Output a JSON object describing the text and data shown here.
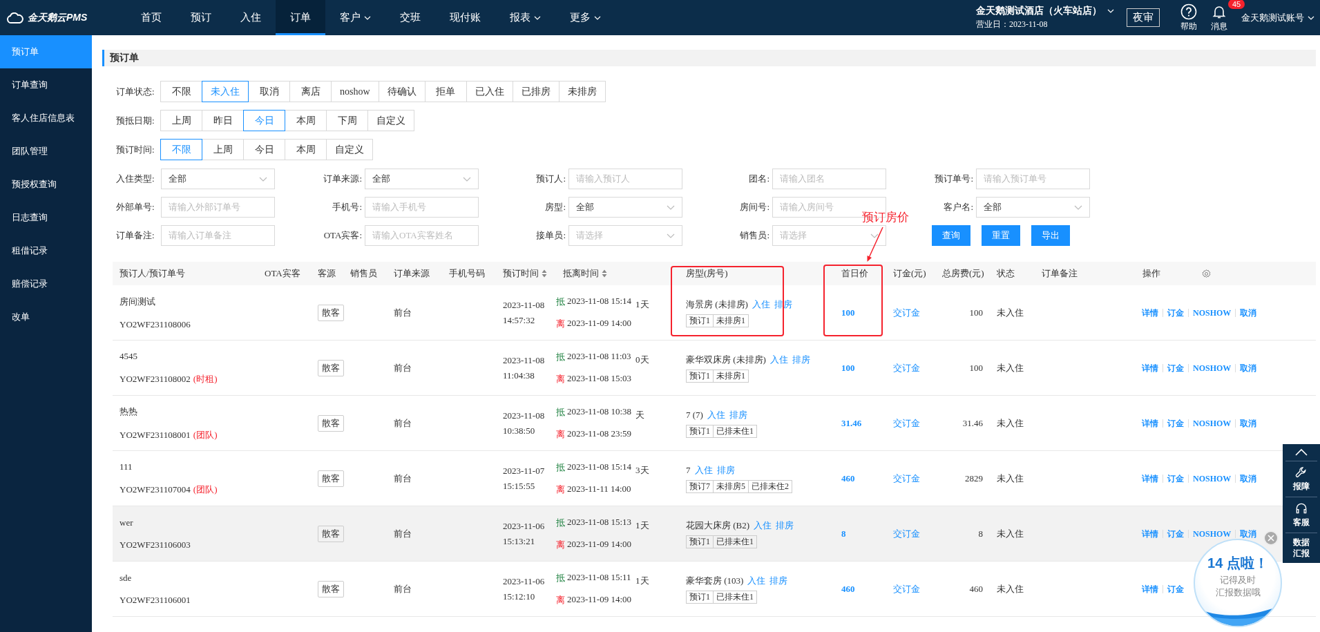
{
  "nav": {
    "logo": "金天鹅云PMS",
    "items": [
      {
        "label": "首页",
        "selected": false,
        "dropdown": false
      },
      {
        "label": "预订",
        "selected": false,
        "dropdown": false
      },
      {
        "label": "入住",
        "selected": false,
        "dropdown": false
      },
      {
        "label": "订单",
        "selected": true,
        "dropdown": false
      },
      {
        "label": "客户",
        "selected": false,
        "dropdown": true
      },
      {
        "label": "交班",
        "selected": false,
        "dropdown": false
      },
      {
        "label": "现付账",
        "selected": false,
        "dropdown": false
      },
      {
        "label": "报表",
        "selected": false,
        "dropdown": true
      },
      {
        "label": "更多",
        "selected": false,
        "dropdown": true
      }
    ],
    "hotel": "金天鹅测试酒店（火车站店）",
    "business_date": "营业日：2023-11-08",
    "night_audit": "夜审",
    "help": "帮助",
    "messages": "消息",
    "message_count": "45",
    "account": "金天鹅测试账号"
  },
  "sidebar": {
    "items": [
      {
        "label": "预订单",
        "selected": true
      },
      {
        "label": "订单查询",
        "selected": false
      },
      {
        "label": "客人住店信息表",
        "selected": false
      },
      {
        "label": "团队管理",
        "selected": false
      },
      {
        "label": "预授权查询",
        "selected": false
      },
      {
        "label": "日志查询",
        "selected": false
      },
      {
        "label": "租借记录",
        "selected": false
      },
      {
        "label": "赔偿记录",
        "selected": false
      },
      {
        "label": "改单",
        "selected": false
      }
    ]
  },
  "page_title": "预订单",
  "filter_groups": [
    {
      "label": "订单状态:",
      "options": [
        {
          "label": "不限",
          "selected": false
        },
        {
          "label": "未入住",
          "selected": true
        },
        {
          "label": "取消",
          "selected": false
        },
        {
          "label": "离店",
          "selected": false
        },
        {
          "label": "noshow",
          "selected": false
        },
        {
          "label": "待确认",
          "selected": false
        },
        {
          "label": "拒单",
          "selected": false
        },
        {
          "label": "已入住",
          "selected": false
        },
        {
          "label": "已排房",
          "selected": false
        },
        {
          "label": "未排房",
          "selected": false
        }
      ]
    },
    {
      "label": "预抵日期:",
      "options": [
        {
          "label": "上周",
          "selected": false
        },
        {
          "label": "昨日",
          "selected": false
        },
        {
          "label": "今日",
          "selected": true
        },
        {
          "label": "本周",
          "selected": false
        },
        {
          "label": "下周",
          "selected": false
        },
        {
          "label": "自定义",
          "selected": false
        }
      ]
    },
    {
      "label": "预订时间:",
      "options": [
        {
          "label": "不限",
          "selected": true
        },
        {
          "label": "上周",
          "selected": false
        },
        {
          "label": "今日",
          "selected": false
        },
        {
          "label": "本周",
          "selected": false
        },
        {
          "label": "自定义",
          "selected": false
        }
      ]
    }
  ],
  "field_rows": [
    [
      {
        "label": "入住类型:",
        "kind": "select",
        "value": "全部"
      },
      {
        "label": "订单来源:",
        "kind": "select",
        "value": "全部"
      },
      {
        "label": "预订人:",
        "kind": "input",
        "placeholder": "请输入预订人"
      },
      {
        "label": "团名:",
        "kind": "input",
        "placeholder": "请输入团名"
      },
      {
        "label": "预订单号:",
        "kind": "input",
        "placeholder": "请输入预订单号"
      }
    ],
    [
      {
        "label": "外部单号:",
        "kind": "input",
        "placeholder": "请输入外部订单号"
      },
      {
        "label": "手机号:",
        "kind": "input",
        "placeholder": "请输入手机号"
      },
      {
        "label": "房型:",
        "kind": "select",
        "value": "全部"
      },
      {
        "label": "房间号:",
        "kind": "input",
        "placeholder": "请输入房间号"
      },
      {
        "label": "客户名:",
        "kind": "select",
        "value": "全部"
      }
    ],
    [
      {
        "label": "订单备注:",
        "kind": "input",
        "placeholder": "请输入订单备注"
      },
      {
        "label": "OTA宾客:",
        "kind": "input",
        "placeholder": "请输入OTA宾客姓名"
      },
      {
        "label": "接单员:",
        "kind": "select",
        "placeholder": "请选择"
      },
      {
        "label": "销售员:",
        "kind": "select",
        "placeholder": "请选择"
      }
    ]
  ],
  "buttons": [
    "查询",
    "重置",
    "导出"
  ],
  "annotation": "预订房价",
  "table": {
    "columns": [
      {
        "label": "预订人/预订单号",
        "sortable": false
      },
      {
        "label": "OTA宾客",
        "sortable": false
      },
      {
        "label": "客源",
        "sortable": false
      },
      {
        "label": "销售员",
        "sortable": false
      },
      {
        "label": "订单来源",
        "sortable": false
      },
      {
        "label": "手机号码",
        "sortable": false
      },
      {
        "label": "预订时间",
        "sortable": true
      },
      {
        "label": "抵离时间",
        "sortable": true
      },
      {
        "label": "房型(房号)",
        "sortable": false
      },
      {
        "label": "首日价",
        "sortable": false
      },
      {
        "label": "订金(元)",
        "sortable": false
      },
      {
        "label": "总房费(元)",
        "sortable": false
      },
      {
        "label": "状态",
        "sortable": false
      },
      {
        "label": "订单备注",
        "sortable": false
      },
      {
        "label": "操作",
        "sortable": false
      }
    ],
    "rows": [
      {
        "booker": "房间测试",
        "order_no": "YO2WF231108006",
        "source": "散客",
        "channel": "前台",
        "booked_date": "2023-11-08",
        "booked_time": "14:57:32",
        "arrive_label": "抵",
        "arrive": "2023-11-08 15:14",
        "depart_label": "离",
        "depart": "2023-11-09 14:00",
        "nights": "1天",
        "room": "海景房 (未排房)",
        "room_links": [
          "入住",
          "排房"
        ],
        "counts": [
          "预订1",
          "未排房1"
        ],
        "first_price": "100",
        "deposit": "交订金",
        "total": "100",
        "status": "未入住",
        "actions": [
          "详情",
          "订金",
          "NOSHOW",
          "取消"
        ],
        "highlighted": false
      },
      {
        "booker": "4545",
        "order_no": "YO2WF231108002",
        "tag": "(时租)",
        "source": "散客",
        "channel": "前台",
        "booked_date": "2023-11-08",
        "booked_time": "11:04:38",
        "arrive_label": "抵",
        "arrive": "2023-11-08 11:03",
        "depart_label": "离",
        "depart": "2023-11-08 15:03",
        "nights": "0天",
        "room": "豪华双床房 (未排房)",
        "room_links": [
          "入住",
          "排房"
        ],
        "counts": [
          "预订1",
          "未排房1"
        ],
        "first_price": "100",
        "deposit": "交订金",
        "total": "100",
        "status": "未入住",
        "actions": [
          "详情",
          "订金",
          "NOSHOW",
          "取消"
        ],
        "highlighted": false
      },
      {
        "booker": "热热",
        "order_no": "YO2WF231108001",
        "tag": "(团队)",
        "source": "散客",
        "channel": "前台",
        "booked_date": "2023-11-08",
        "booked_time": "10:38:50",
        "arrive_label": "抵",
        "arrive": "2023-11-08 10:38",
        "depart_label": "离",
        "depart": "2023-11-08 23:59",
        "nights": "天",
        "room": "7 (7)",
        "room_links": [
          "入住",
          "排房"
        ],
        "counts": [
          "预订1",
          "已排未住1"
        ],
        "first_price": "31.46",
        "deposit": "交订金",
        "total": "31.46",
        "status": "未入住",
        "actions": [
          "详情",
          "订金",
          "NOSHOW",
          "取消"
        ],
        "highlighted": false
      },
      {
        "booker": "111",
        "order_no": "YO2WF231107004",
        "tag": "(团队)",
        "source": "散客",
        "channel": "前台",
        "booked_date": "2023-11-07",
        "booked_time": "15:15:55",
        "arrive_label": "抵",
        "arrive": "2023-11-08 15:14",
        "depart_label": "离",
        "depart": "2023-11-11 14:00",
        "nights": "3天",
        "room": "7",
        "room_links": [
          "入住",
          "排房"
        ],
        "counts": [
          "预订7",
          "未排房5",
          "已排未住2"
        ],
        "first_price": "460",
        "deposit": "交订金",
        "total": "2829",
        "status": "未入住",
        "actions": [
          "详情",
          "订金",
          "NOSHOW",
          "取消"
        ],
        "highlighted": false
      },
      {
        "booker": "wer",
        "order_no": "YO2WF231106003",
        "source": "散客",
        "channel": "前台",
        "booked_date": "2023-11-06",
        "booked_time": "15:13:21",
        "arrive_label": "抵",
        "arrive": "2023-11-08 15:13",
        "depart_label": "离",
        "depart": "2023-11-09 14:00",
        "nights": "1天",
        "room": "花园大床房 (B2)",
        "room_links": [
          "入住",
          "排房"
        ],
        "counts": [
          "预订1",
          "已排未住1"
        ],
        "first_price": "8",
        "deposit": "交订金",
        "total": "8",
        "status": "未入住",
        "actions": [
          "详情",
          "订金",
          "NOSHOW",
          "取消"
        ],
        "highlighted": true
      },
      {
        "booker": "sde",
        "order_no": "YO2WF231106001",
        "source": "散客",
        "channel": "前台",
        "booked_date": "2023-11-06",
        "booked_time": "15:12:10",
        "arrive_label": "抵",
        "arrive": "2023-11-08 15:11",
        "depart_label": "离",
        "depart": "2023-11-09 14:00",
        "nights": "1天",
        "room": "豪华套房 (103)",
        "room_links": [
          "入住",
          "排房"
        ],
        "counts": [
          "预订1",
          "已排未住1"
        ],
        "first_price": "460",
        "deposit": "交订金",
        "total": "460",
        "status": "未入住",
        "actions": [
          "详情",
          "订金"
        ],
        "highlighted": false
      }
    ]
  },
  "side_tools": [
    {
      "kind": "up"
    },
    {
      "kind": "wrench",
      "label": "报障"
    },
    {
      "kind": "headset",
      "label": "客服"
    },
    {
      "kind": "text",
      "label": "数据汇报"
    }
  ],
  "popup": {
    "title": "14 点啦！",
    "lines": [
      "记得及时",
      "汇报数据哦"
    ]
  }
}
